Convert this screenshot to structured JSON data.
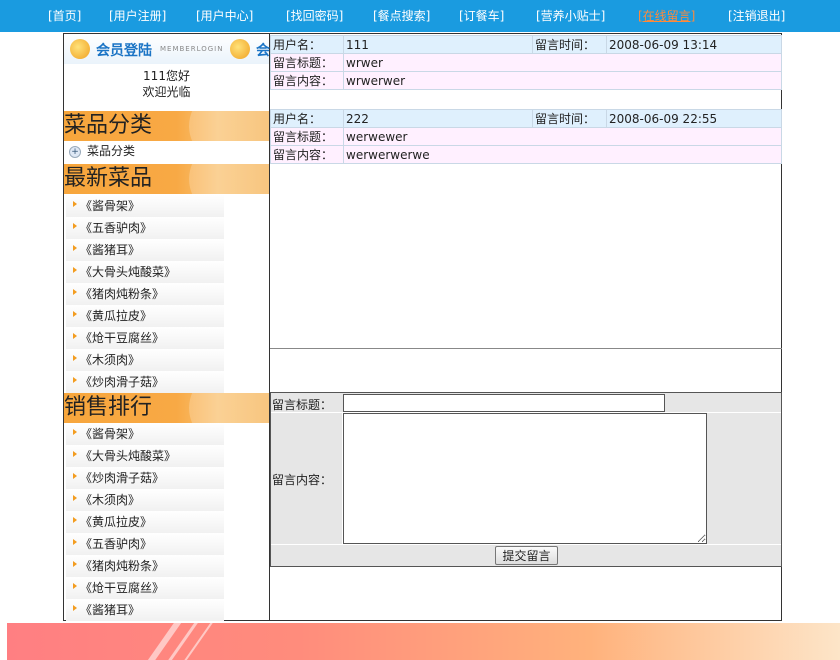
{
  "nav": {
    "items": [
      {
        "label": "[首页]"
      },
      {
        "label": "[用户注册]"
      },
      {
        "label": "[用户中心]"
      },
      {
        "label": "[找回密码]"
      },
      {
        "label": "[餐点搜索]"
      },
      {
        "label": "[订餐车]"
      },
      {
        "label": "[营养小贴士]"
      },
      {
        "label": "[在线留言]"
      },
      {
        "label": "[注销退出]"
      }
    ],
    "active_color": "#ff8a3a",
    "bar_color": "#1a9be0"
  },
  "sidebar": {
    "member_banner": {
      "logo_text": "会员登陆",
      "sub_text": "MEMBERLOGIN"
    },
    "greeting": "111您好",
    "welcome": "欢迎光临",
    "category_title": "菜品分类",
    "category_item": "菜品分类",
    "latest_title": "最新菜品",
    "latest_items": [
      "《酱骨架》",
      "《五香驴肉》",
      "《酱猪耳》",
      "《大骨头炖酸菜》",
      "《猪肉炖粉条》",
      "《黄瓜拉皮》",
      "《炝干豆腐丝》",
      "《木须肉》",
      "《炒肉滑子菇》"
    ],
    "sales_title": "销售排行",
    "sales_items": [
      "《酱骨架》",
      "《大骨头炖酸菜》",
      "《炒肉滑子菇》",
      "《木须肉》",
      "《黄瓜拉皮》",
      "《五香驴肉》",
      "《猪肉炖粉条》",
      "《炝干豆腐丝》",
      "《酱猪耳》"
    ]
  },
  "messages": {
    "labels": {
      "user": "用户名：",
      "time": "留言时间：",
      "title": "留言标题：",
      "content": "留言内容："
    },
    "items": [
      {
        "user": "111",
        "time": "2008-06-09 13:14",
        "title": "wrwer",
        "content": "wrwerwer"
      },
      {
        "user": "222",
        "time": "2008-06-09 22:55",
        "title": "werwewer",
        "content": "werwerwerwe"
      }
    ]
  },
  "form": {
    "title_label": "留言标题：",
    "content_label": "留言内容：",
    "submit_label": "提交留言",
    "title_value": "",
    "content_value": ""
  }
}
